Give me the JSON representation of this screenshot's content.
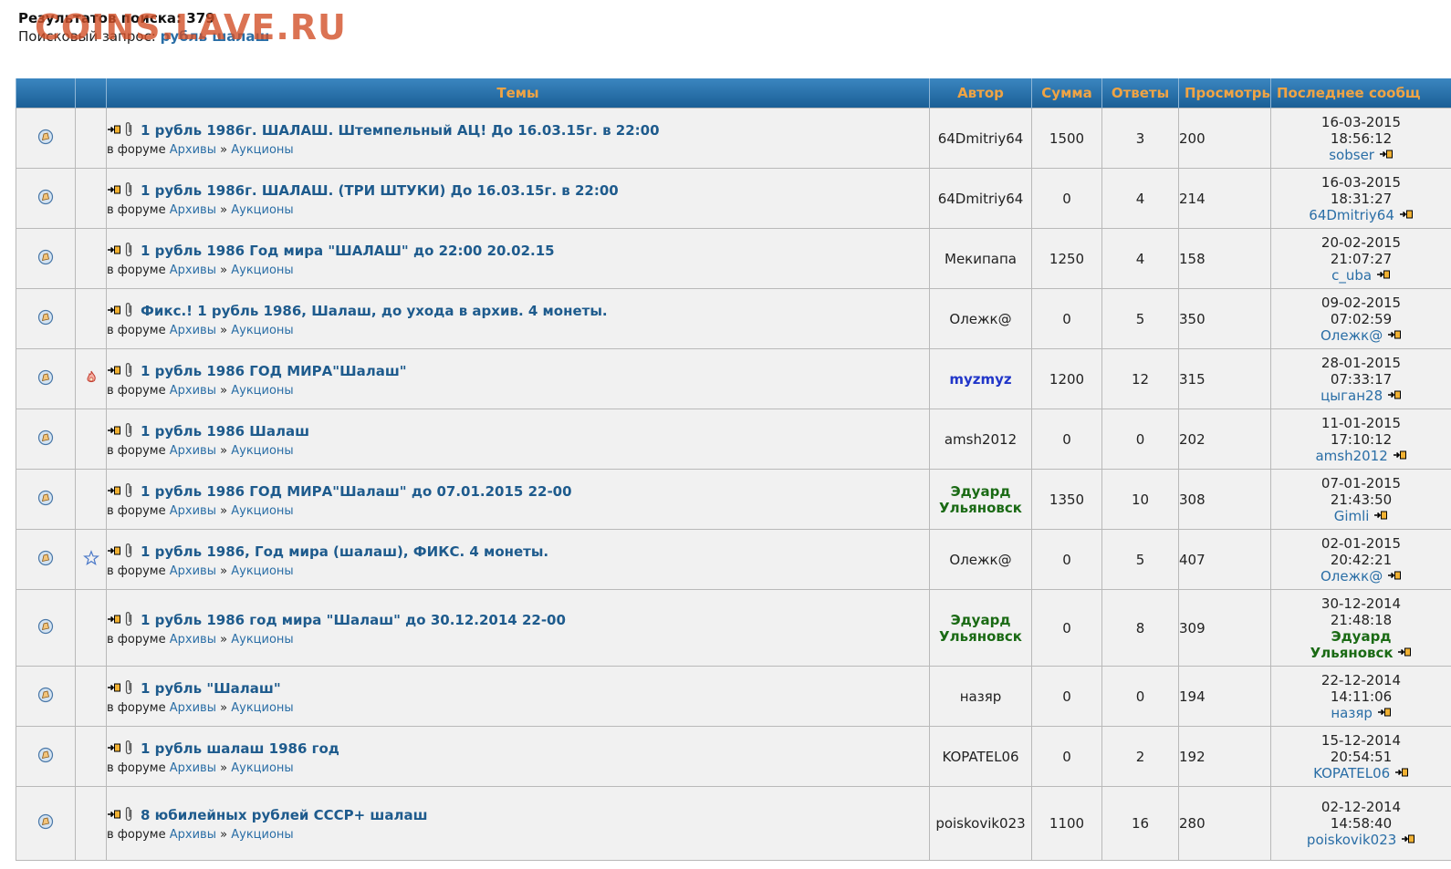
{
  "header": {
    "results_label": "Результатов поиска: 379",
    "query_label": "Поисковый запрос:",
    "query_value": "рубль шалаш",
    "watermark": "COINS.LAVE.RU"
  },
  "columns": {
    "topics": "Темы",
    "author": "Автор",
    "sum": "Сумма",
    "replies": "Ответы",
    "views": "Просмотры",
    "last": "Последнее сообщ"
  },
  "forum_prefix": "в форуме",
  "forum_sep": "»",
  "rows": [
    {
      "title": "1 рубль 1986г. ШАЛАШ. Штемпельный АЦ! До 16.03.15г. в 22:00",
      "forum": "Архивы",
      "subforum": "Аукционы",
      "author": "64Dmitriy64",
      "author_l1": "64Dmitriy64",
      "author_l2": "",
      "sum": "1500",
      "replies": "3",
      "views": "200",
      "last_date": "16-03-2015",
      "last_time": "18:56:12",
      "last_user": "sobser",
      "last_user_l1": "sobser",
      "last_user_l2": "",
      "flag": "",
      "author_style": "",
      "last_style": ""
    },
    {
      "title": "1 рубль 1986г. ШАЛАШ. (ТРИ ШТУКИ) До 16.03.15г. в 22:00",
      "forum": "Архивы",
      "subforum": "Аукционы",
      "author": "64Dmitriy64",
      "author_l1": "64Dmitriy64",
      "author_l2": "",
      "sum": "0",
      "replies": "4",
      "views": "214",
      "last_date": "16-03-2015",
      "last_time": "18:31:27",
      "last_user": "64Dmitriy64",
      "last_user_l1": "64Dmitriy64",
      "last_user_l2": "",
      "flag": "",
      "author_style": "",
      "last_style": ""
    },
    {
      "title": "1 рубль 1986 Год мира \"ШАЛАШ\" до 22:00 20.02.15",
      "forum": "Архивы",
      "subforum": "Аукционы",
      "author": "Мекипапа",
      "author_l1": "Мекипапа",
      "author_l2": "",
      "sum": "1250",
      "replies": "4",
      "views": "158",
      "last_date": "20-02-2015",
      "last_time": "21:07:27",
      "last_user": "c_uba",
      "last_user_l1": "c_uba",
      "last_user_l2": "",
      "flag": "",
      "author_style": "",
      "last_style": ""
    },
    {
      "title": "Фикс.! 1 рубль 1986, Шалаш, до ухода в архив. 4 монеты.",
      "forum": "Архивы",
      "subforum": "Аукционы",
      "author": "Олежк@",
      "author_l1": "Олежк@",
      "author_l2": "",
      "sum": "0",
      "replies": "5",
      "views": "350",
      "last_date": "09-02-2015",
      "last_time": "07:02:59",
      "last_user": "Олежк@",
      "last_user_l1": "Олежк@",
      "last_user_l2": "",
      "flag": "",
      "author_style": "",
      "last_style": ""
    },
    {
      "title": "1 рубль 1986 ГОД МИРА\"Шалаш\"",
      "forum": "Архивы",
      "subforum": "Аукционы",
      "author": "myzmyz",
      "author_l1": "myzmyz",
      "author_l2": "",
      "sum": "1200",
      "replies": "12",
      "views": "315",
      "last_date": "28-01-2015",
      "last_time": "07:33:17",
      "last_user": "цыган28",
      "last_user_l1": "цыган28",
      "last_user_l2": "",
      "flag": "fire",
      "author_style": "bold-blue",
      "last_style": ""
    },
    {
      "title": "1 рубль 1986 Шалаш",
      "forum": "Архивы",
      "subforum": "Аукционы",
      "author": "amsh2012",
      "author_l1": "amsh2012",
      "author_l2": "",
      "sum": "0",
      "replies": "0",
      "views": "202",
      "last_date": "11-01-2015",
      "last_time": "17:10:12",
      "last_user": "amsh2012",
      "last_user_l1": "amsh2012",
      "last_user_l2": "",
      "flag": "",
      "author_style": "",
      "last_style": ""
    },
    {
      "title": "1 рубль 1986 ГОД МИРА\"Шалаш\" до 07.01.2015 22-00",
      "forum": "Архивы",
      "subforum": "Аукционы",
      "author": "Эдуард Ульяновск",
      "author_l1": "Эдуард",
      "author_l2": "Ульяновск",
      "sum": "1350",
      "replies": "10",
      "views": "308",
      "last_date": "07-01-2015",
      "last_time": "21:43:50",
      "last_user": "Gimli",
      "last_user_l1": "Gimli",
      "last_user_l2": "",
      "flag": "",
      "author_style": "bold-green",
      "last_style": ""
    },
    {
      "title": "1 рубль 1986, Год мира (шалаш), ФИКС. 4 монеты.",
      "forum": "Архивы",
      "subforum": "Аукционы",
      "author": "Олежк@",
      "author_l1": "Олежк@",
      "author_l2": "",
      "sum": "0",
      "replies": "5",
      "views": "407",
      "last_date": "02-01-2015",
      "last_time": "20:42:21",
      "last_user": "Олежк@",
      "last_user_l1": "Олежк@",
      "last_user_l2": "",
      "flag": "star",
      "author_style": "",
      "last_style": ""
    },
    {
      "title": "1 рубль 1986 год мира \"Шалаш\" до 30.12.2014 22-00",
      "forum": "Архивы",
      "subforum": "Аукционы",
      "author": "Эдуард Ульяновск",
      "author_l1": "Эдуард",
      "author_l2": "Ульяновск",
      "sum": "0",
      "replies": "8",
      "views": "309",
      "last_date": "30-12-2014",
      "last_time": "21:48:18",
      "last_user": "Эдуард Ульяновск",
      "last_user_l1": "Эдуард",
      "last_user_l2": "Ульяновск",
      "flag": "",
      "author_style": "bold-green",
      "last_style": "bold-green"
    },
    {
      "title": "1 рубль \"Шалаш\"",
      "forum": "Архивы",
      "subforum": "Аукционы",
      "author": "назяр",
      "author_l1": "назяр",
      "author_l2": "",
      "sum": "0",
      "replies": "0",
      "views": "194",
      "last_date": "22-12-2014",
      "last_time": "14:11:06",
      "last_user": "назяр",
      "last_user_l1": "назяр",
      "last_user_l2": "",
      "flag": "",
      "author_style": "",
      "last_style": ""
    },
    {
      "title": "1 рубль шалаш 1986 год",
      "forum": "Архивы",
      "subforum": "Аукционы",
      "author": "KOPATEL06",
      "author_l1": "KOPATEL06",
      "author_l2": "",
      "sum": "0",
      "replies": "2",
      "views": "192",
      "last_date": "15-12-2014",
      "last_time": "20:54:51",
      "last_user": "KOPATEL06",
      "last_user_l1": "KOPATEL06",
      "last_user_l2": "",
      "flag": "",
      "author_style": "",
      "last_style": ""
    },
    {
      "title": "8 юбилейных рублей СССР+ шалаш",
      "forum": "Архивы",
      "subforum": "Аукционы",
      "author": "poiskovik023",
      "author_l1": "poiskovik023",
      "author_l2": "",
      "sum": "1100",
      "replies": "16",
      "views": "280",
      "last_date": "02-12-2014",
      "last_time": "14:58:40",
      "last_user": "poiskovik023",
      "last_user_l1": "poiskovik023",
      "last_user_l2": "",
      "flag": "",
      "author_style": "",
      "last_style": ""
    }
  ]
}
